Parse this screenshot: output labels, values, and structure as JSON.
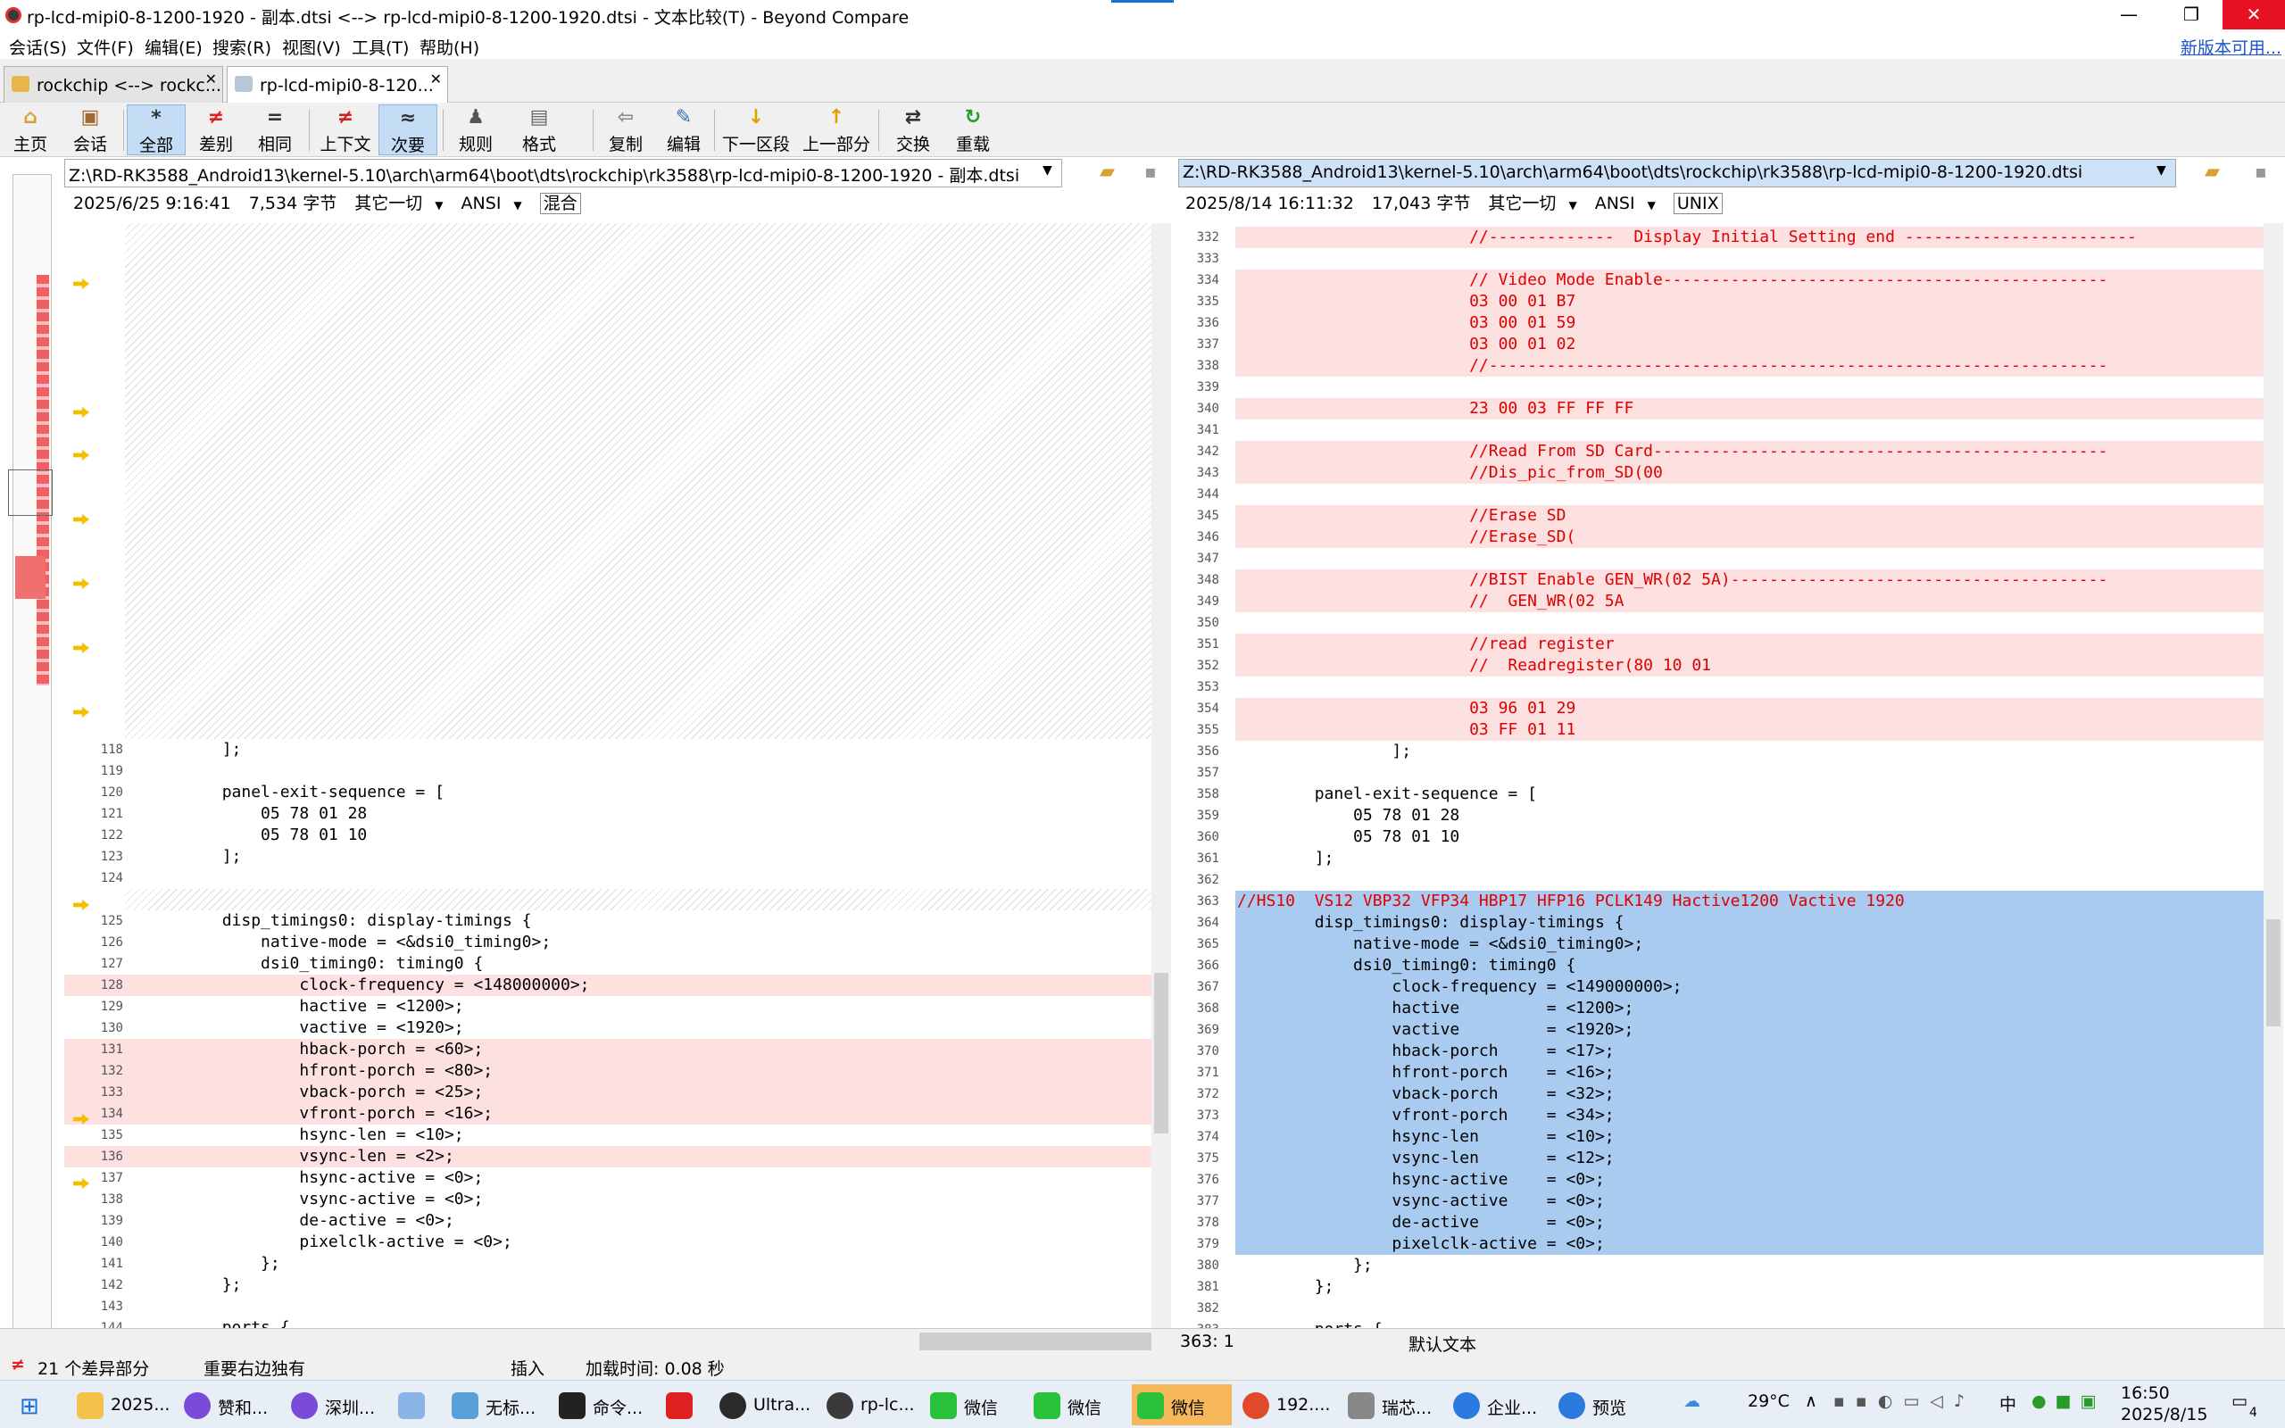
{
  "window": {
    "title": "rp-lcd-mipi0-8-1200-1920 - 副本.dtsi <--> rp-lcd-mipi0-8-1200-1920.dtsi - 文本比较(T) - Beyond Compare",
    "min": "—",
    "restore": "❐",
    "close": "✕"
  },
  "menu": {
    "items": [
      "会话(S)",
      "文件(F)",
      "编辑(E)",
      "搜索(R)",
      "视图(V)",
      "工具(T)",
      "帮助(H)"
    ],
    "new_version": "新版本可用..."
  },
  "tabs": [
    {
      "label": "rockchip <--> rockc...",
      "close": "✕"
    },
    {
      "label": "rp-lcd-mipi0-8-120...",
      "close": "✕"
    }
  ],
  "toolbar": {
    "home": "主页",
    "session": "会话",
    "all": "全部",
    "diffs": "差别",
    "same": "相同",
    "context": "上下文",
    "minor": "次要",
    "rules": "规则",
    "format": "格式",
    "copy": "复制",
    "edit": "编辑",
    "next_section": "下一区段",
    "prev_section": "上一部分",
    "swap": "交换",
    "reload": "重载"
  },
  "left": {
    "path": "Z:\\RD-RK3588_Android13\\kernel-5.10\\arch\\arm64\\boot\\dts\\rockchip\\rk3588\\rp-lcd-mipi0-8-1200-1920 - 副本.dtsi",
    "date": "2025/6/25 9:16:41",
    "size": "7,534 字节",
    "filter": "其它一切",
    "encoding": "ANSI",
    "eol": "混合"
  },
  "right": {
    "path": "Z:\\RD-RK3588_Android13\\kernel-5.10\\arch\\arm64\\boot\\dts\\rockchip\\rk3588\\rp-lcd-mipi0-8-1200-1920.dtsi",
    "date": "2025/8/14 16:11:32",
    "size": "17,043 字节",
    "filter": "其它一切",
    "encoding": "ANSI",
    "eol": "UNIX"
  },
  "left_lines": [
    {
      "n": "118",
      "t": "        ];",
      "c": ""
    },
    {
      "n": "119",
      "t": "",
      "c": ""
    },
    {
      "n": "120",
      "t": "        panel-exit-sequence = [",
      "c": ""
    },
    {
      "n": "121",
      "t": "            05 78 01 28",
      "c": ""
    },
    {
      "n": "122",
      "t": "            05 78 01 10",
      "c": ""
    },
    {
      "n": "123",
      "t": "        ];",
      "c": ""
    },
    {
      "n": "124",
      "t": "",
      "c": ""
    },
    {
      "n": "",
      "t": "",
      "c": "gap"
    },
    {
      "n": "125",
      "t": "        disp_timings0: display-timings {",
      "c": ""
    },
    {
      "n": "126",
      "t": "            native-mode = <&dsi0_timing0>;",
      "c": ""
    },
    {
      "n": "127",
      "t": "            dsi0_timing0: timing0 {",
      "c": ""
    },
    {
      "n": "128",
      "t": "                clock-frequency = <148000000>;",
      "c": "diff"
    },
    {
      "n": "129",
      "t": "                hactive = <1200>;",
      "c": ""
    },
    {
      "n": "130",
      "t": "                vactive = <1920>;",
      "c": ""
    },
    {
      "n": "131",
      "t": "                hback-porch = <60>;",
      "c": "diff"
    },
    {
      "n": "132",
      "t": "                hfront-porch = <80>;",
      "c": "diff"
    },
    {
      "n": "133",
      "t": "                vback-porch = <25>;",
      "c": "diff"
    },
    {
      "n": "134",
      "t": "                vfront-porch = <16>;",
      "c": "diff"
    },
    {
      "n": "135",
      "t": "                hsync-len = <10>;",
      "c": ""
    },
    {
      "n": "136",
      "t": "                vsync-len = <2>;",
      "c": "diff"
    },
    {
      "n": "137",
      "t": "                hsync-active = <0>;",
      "c": ""
    },
    {
      "n": "138",
      "t": "                vsync-active = <0>;",
      "c": ""
    },
    {
      "n": "139",
      "t": "                de-active = <0>;",
      "c": ""
    },
    {
      "n": "140",
      "t": "                pixelclk-active = <0>;",
      "c": ""
    },
    {
      "n": "141",
      "t": "            };",
      "c": ""
    },
    {
      "n": "142",
      "t": "        };",
      "c": ""
    },
    {
      "n": "143",
      "t": "",
      "c": ""
    },
    {
      "n": "144",
      "t": "        ports {",
      "c": ""
    }
  ],
  "right_lines": [
    {
      "n": "332",
      "t": "                        //-------------  Display Initial Setting end ------------------------",
      "c": "diff"
    },
    {
      "n": "333",
      "t": "",
      "c": ""
    },
    {
      "n": "334",
      "t": "                        // Video Mode Enable----------------------------------------------",
      "c": "diff"
    },
    {
      "n": "335",
      "t": "                        03 00 01 B7",
      "c": "diff"
    },
    {
      "n": "336",
      "t": "                        03 00 01 59",
      "c": "diff"
    },
    {
      "n": "337",
      "t": "                        03 00 01 02",
      "c": "diff"
    },
    {
      "n": "338",
      "t": "                        //----------------------------------------------------------------",
      "c": "diff"
    },
    {
      "n": "339",
      "t": "",
      "c": ""
    },
    {
      "n": "340",
      "t": "                        23 00 03 FF FF FF",
      "c": "diff"
    },
    {
      "n": "341",
      "t": "",
      "c": ""
    },
    {
      "n": "342",
      "t": "                        //Read From SD Card-----------------------------------------------",
      "c": "diff"
    },
    {
      "n": "343",
      "t": "                        //Dis_pic_from_SD(00",
      "c": "diff"
    },
    {
      "n": "344",
      "t": "",
      "c": ""
    },
    {
      "n": "345",
      "t": "                        //Erase SD",
      "c": "diff"
    },
    {
      "n": "346",
      "t": "                        //Erase_SD(",
      "c": "diff"
    },
    {
      "n": "347",
      "t": "",
      "c": ""
    },
    {
      "n": "348",
      "t": "                        //BIST Enable GEN_WR(02 5A)---------------------------------------",
      "c": "diff"
    },
    {
      "n": "349",
      "t": "                        //  GEN_WR(02 5A",
      "c": "diff"
    },
    {
      "n": "350",
      "t": "",
      "c": ""
    },
    {
      "n": "351",
      "t": "                        //read register",
      "c": "diff"
    },
    {
      "n": "352",
      "t": "                        //  Readregister(80 10 01",
      "c": "diff"
    },
    {
      "n": "353",
      "t": "",
      "c": ""
    },
    {
      "n": "354",
      "t": "                        03 96 01 29",
      "c": "diff"
    },
    {
      "n": "355",
      "t": "                        03 FF 01 11",
      "c": "diff"
    },
    {
      "n": "356",
      "t": "                ];",
      "c": ""
    },
    {
      "n": "357",
      "t": "",
      "c": ""
    },
    {
      "n": "358",
      "t": "        panel-exit-sequence = [",
      "c": ""
    },
    {
      "n": "359",
      "t": "            05 78 01 28",
      "c": ""
    },
    {
      "n": "360",
      "t": "            05 78 01 10",
      "c": ""
    },
    {
      "n": "361",
      "t": "        ];",
      "c": ""
    },
    {
      "n": "362",
      "t": "",
      "c": ""
    },
    {
      "n": "363",
      "t": "//HS10  VS12 VBP32 VFP34 HBP17 HFP16 PCLK149 Hactive1200 Vactive 1920",
      "c": "selred"
    },
    {
      "n": "364",
      "t": "        disp_timings0: display-timings {",
      "c": "sel"
    },
    {
      "n": "365",
      "t": "            native-mode = <&dsi0_timing0>;",
      "c": "sel"
    },
    {
      "n": "366",
      "t": "            dsi0_timing0: timing0 {",
      "c": "sel"
    },
    {
      "n": "367",
      "t": "                clock-frequency = <149000000>;",
      "c": "sel"
    },
    {
      "n": "368",
      "t": "                hactive         = <1200>;",
      "c": "sel"
    },
    {
      "n": "369",
      "t": "                vactive         = <1920>;",
      "c": "sel"
    },
    {
      "n": "370",
      "t": "                hback-porch     = <17>;",
      "c": "sel"
    },
    {
      "n": "371",
      "t": "                hfront-porch    = <16>;",
      "c": "sel"
    },
    {
      "n": "372",
      "t": "                vback-porch     = <32>;",
      "c": "sel"
    },
    {
      "n": "373",
      "t": "                vfront-porch    = <34>;",
      "c": "sel"
    },
    {
      "n": "374",
      "t": "                hsync-len       = <10>;",
      "c": "sel"
    },
    {
      "n": "375",
      "t": "                vsync-len       = <12>;",
      "c": "sel"
    },
    {
      "n": "376",
      "t": "                hsync-active    = <0>;",
      "c": "sel"
    },
    {
      "n": "377",
      "t": "                vsync-active    = <0>;",
      "c": "sel"
    },
    {
      "n": "378",
      "t": "                de-active       = <0>;",
      "c": "sel"
    },
    {
      "n": "379",
      "t": "                pixelclk-active = <0>;",
      "c": "sel"
    },
    {
      "n": "380",
      "t": "            };",
      "c": ""
    },
    {
      "n": "381",
      "t": "        };",
      "c": ""
    },
    {
      "n": "382",
      "t": "",
      "c": ""
    },
    {
      "n": "383",
      "t": "        ports {",
      "c": ""
    }
  ],
  "status": {
    "diff_count": "21 个差异部分",
    "important": "重要右边独有",
    "insert": "插入",
    "load_time": "加载时间: 0.08 秒",
    "position": "363: 1",
    "default_text": "默认文本"
  },
  "taskbar": {
    "items": [
      "2025...",
      "赞和...",
      "深圳...",
      "",
      "无标...",
      "命令...",
      "",
      "Ultra...",
      "rp-lc...",
      "微信",
      "微信",
      "微信",
      "192....",
      "瑞芯...",
      "企业...",
      "预览"
    ],
    "weather": "29°C",
    "time": "16:50",
    "date": "2025/8/15",
    "ime": "中",
    "notif": "4"
  }
}
